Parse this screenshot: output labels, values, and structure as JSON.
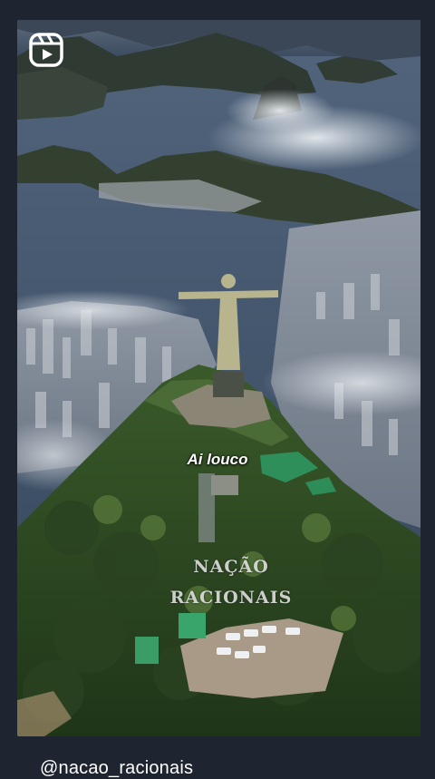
{
  "post": {
    "caption_overlay": "Ai louco",
    "watermark_line1": "NAÇÃO",
    "watermark_line2": "RACIONAIS",
    "username": "@nacao_racionais"
  },
  "icons": {
    "reels": "reels-icon"
  },
  "colors": {
    "background": "#1e2430",
    "text": "#ffffff"
  }
}
